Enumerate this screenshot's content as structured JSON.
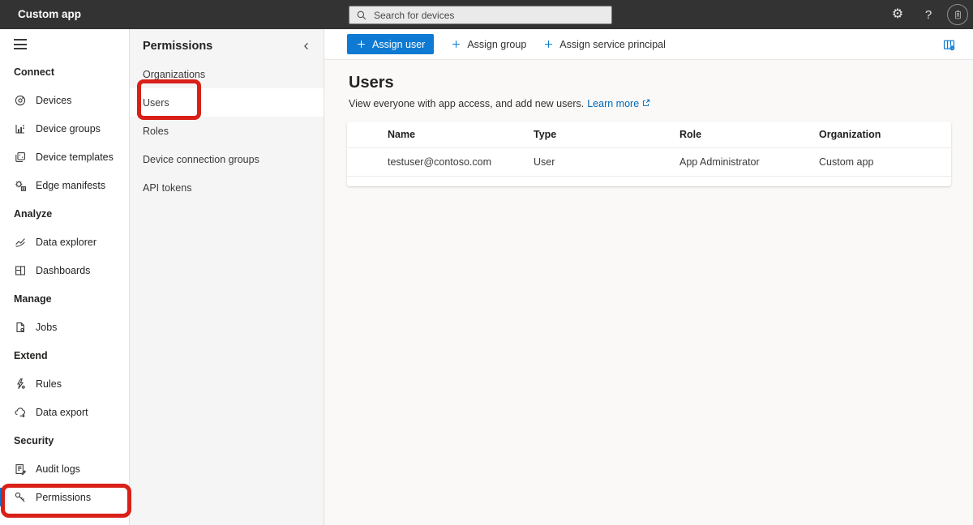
{
  "topbar": {
    "app_title": "Custom app",
    "search_placeholder": "Search for devices"
  },
  "sidebar": {
    "sections": [
      {
        "label": "Connect",
        "items": [
          {
            "label": "Devices",
            "icon": "devices-icon"
          },
          {
            "label": "Device groups",
            "icon": "device-groups-icon"
          },
          {
            "label": "Device templates",
            "icon": "device-templates-icon"
          },
          {
            "label": "Edge manifests",
            "icon": "edge-manifests-icon"
          }
        ]
      },
      {
        "label": "Analyze",
        "items": [
          {
            "label": "Data explorer",
            "icon": "data-explorer-icon"
          },
          {
            "label": "Dashboards",
            "icon": "dashboards-icon"
          }
        ]
      },
      {
        "label": "Manage",
        "items": [
          {
            "label": "Jobs",
            "icon": "jobs-icon"
          }
        ]
      },
      {
        "label": "Extend",
        "items": [
          {
            "label": "Rules",
            "icon": "rules-icon"
          },
          {
            "label": "Data export",
            "icon": "data-export-icon"
          }
        ]
      },
      {
        "label": "Security",
        "items": [
          {
            "label": "Audit logs",
            "icon": "audit-logs-icon"
          },
          {
            "label": "Permissions",
            "icon": "permissions-icon",
            "selected": true,
            "annotated": true
          }
        ]
      }
    ]
  },
  "panel": {
    "title": "Permissions",
    "items": [
      {
        "label": "Organizations"
      },
      {
        "label": "Users",
        "selected": true,
        "annotated": true
      },
      {
        "label": "Roles"
      },
      {
        "label": "Device connection groups"
      },
      {
        "label": "API tokens"
      }
    ]
  },
  "toolbar": {
    "primary_button": "Assign user",
    "secondary_buttons": [
      "Assign group",
      "Assign service principal"
    ]
  },
  "main": {
    "heading": "Users",
    "description": "View everyone with app access, and add new users.",
    "learn_more": "Learn more",
    "table": {
      "columns": [
        "Name",
        "Type",
        "Role",
        "Organization"
      ],
      "rows": [
        [
          "testuser@contoso.com",
          "User",
          "App Administrator",
          "Custom app"
        ]
      ]
    }
  },
  "colors": {
    "accent": "#0078d4",
    "topbar_bg": "#333333",
    "link": "#0067b8",
    "annotation_red": "#d92018"
  }
}
